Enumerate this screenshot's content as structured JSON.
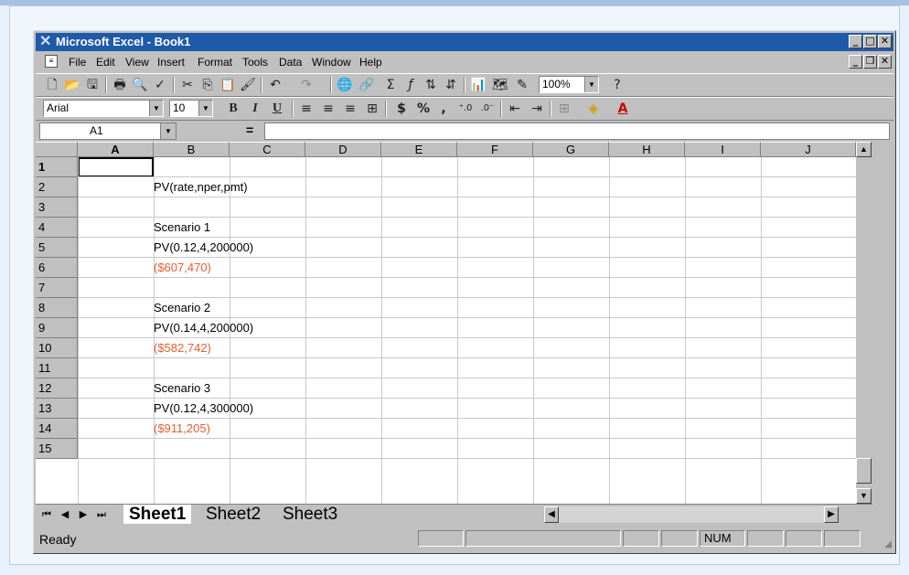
{
  "window": {
    "title": "Microsoft Excel - Book1"
  },
  "menu": [
    "File",
    "Edit",
    "View",
    "Insert",
    "Format",
    "Tools",
    "Data",
    "Window",
    "Help"
  ],
  "toolbar": {
    "zoom": "100%",
    "font": "Arial",
    "font_size": "10",
    "bold": "B",
    "italic": "I",
    "underline": "U",
    "currency": "$",
    "percent": "%",
    "comma": ","
  },
  "formula_bar": {
    "name_box": "A1",
    "equals": "="
  },
  "columns": [
    "A",
    "B",
    "C",
    "D",
    "E",
    "F",
    "G",
    "H",
    "I",
    "J"
  ],
  "rows": [
    "1",
    "2",
    "3",
    "4",
    "5",
    "6",
    "7",
    "8",
    "9",
    "10",
    "11",
    "12",
    "13",
    "14",
    "15"
  ],
  "cells": [
    {
      "row": 2,
      "text": "PV(rate,nper,pmt)"
    },
    {
      "row": 4,
      "text": "Scenario 1"
    },
    {
      "row": 5,
      "text": "PV(0.12,4,200000)"
    },
    {
      "row": 6,
      "text": "($607,470)",
      "style": "negative"
    },
    {
      "row": 8,
      "text": "Scenario 2"
    },
    {
      "row": 9,
      "text": "PV(0.14,4,200000)"
    },
    {
      "row": 10,
      "text": "($582,742)",
      "style": "negative"
    },
    {
      "row": 12,
      "text": "Scenario 3"
    },
    {
      "row": 13,
      "text": "PV(0.12,4,300000)"
    },
    {
      "row": 14,
      "text": "($911,205)",
      "style": "negative"
    }
  ],
  "sheets": [
    "Sheet1",
    "Sheet2",
    "Sheet3"
  ],
  "active_sheet": "Sheet1",
  "status": {
    "text": "Ready",
    "num": "NUM"
  },
  "colors": {
    "title_bar": "#1e5aa8",
    "negative_value": "#e06030",
    "chrome": "#c0c0c0"
  }
}
